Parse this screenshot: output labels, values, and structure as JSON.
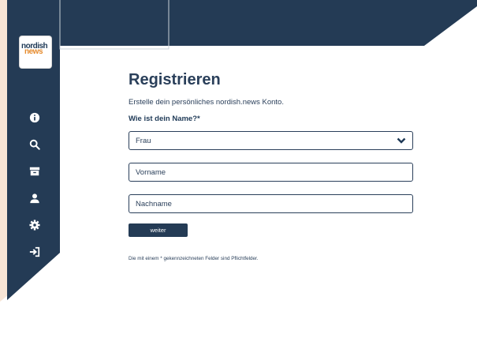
{
  "logo": {
    "line1": "nordish",
    "line2": "news"
  },
  "nav": {
    "icons": [
      "info-icon",
      "search-icon",
      "archive-icon",
      "user-icon",
      "settings-icon",
      "login-icon"
    ]
  },
  "form": {
    "title": "Registrieren",
    "subtitle": "Erstelle dein persönliches nordish.news Konto.",
    "name_label": "Wie ist dein Name?*",
    "salutation_value": "Frau",
    "first_name_placeholder": "Vorname",
    "last_name_placeholder": "Nachname",
    "submit_label": "weiter",
    "footnote": "Die mit einem * gekennzeichneten Felder sind Pflichtfelder."
  },
  "colors": {
    "navy": "#243b55",
    "peach": "#f7e5d6",
    "logo_orange": "#e58a2c"
  }
}
